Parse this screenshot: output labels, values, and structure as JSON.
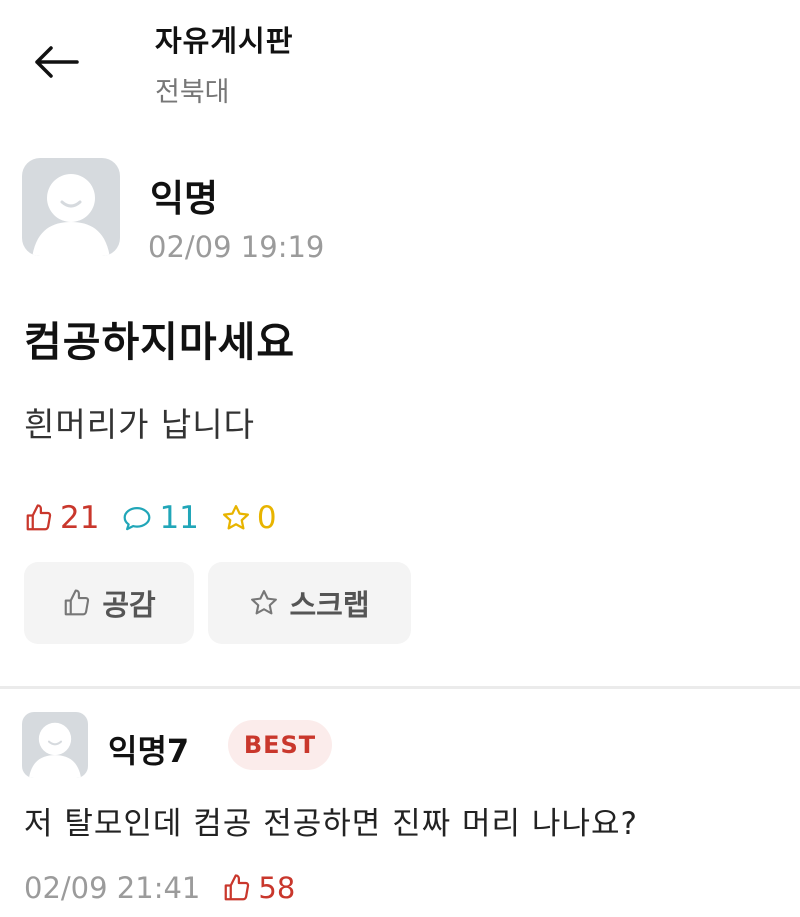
{
  "header": {
    "title": "자유게시판",
    "subtitle": "전북대"
  },
  "post": {
    "author": "익명",
    "timestamp": "02/09 19:19",
    "title": "컴공하지마세요",
    "body": "흰머리가 납니다",
    "stats": {
      "likes": "21",
      "comments": "11",
      "scraps": "0"
    },
    "actions": {
      "empathy_label": "공감",
      "scrap_label": "스크랩"
    }
  },
  "comment": {
    "author": "익명7",
    "badge": "BEST",
    "text": "저 탈모인데 컴공 전공하면 진짜 머리 나나요?",
    "timestamp": "02/09 21:41",
    "likes": "58"
  },
  "colors": {
    "like_red": "#c9372c",
    "comment_teal": "#21a6b8",
    "scrap_yellow": "#e8b400",
    "avatar_gray": "#d6dade"
  },
  "icons": [
    "back-arrow-icon",
    "thumbs-up-icon",
    "speech-bubble-icon",
    "star-icon",
    "default-avatar-icon"
  ]
}
